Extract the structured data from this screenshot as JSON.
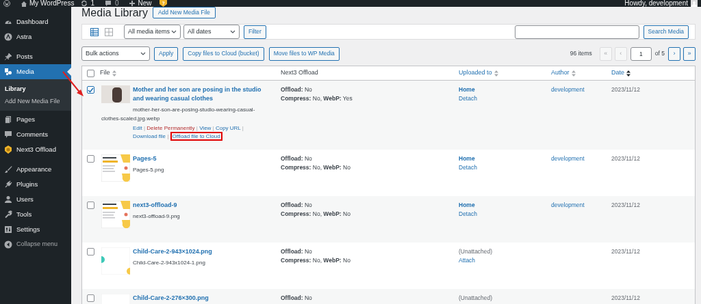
{
  "admin_bar": {
    "items": [
      {
        "kind": "wp-logo"
      },
      {
        "kind": "site",
        "label": "My WordPress"
      },
      {
        "kind": "updates",
        "label": "1"
      },
      {
        "kind": "comments",
        "label": "0"
      },
      {
        "kind": "new",
        "label": "New"
      },
      {
        "kind": "plugin"
      }
    ],
    "greeting": "Howdy, development"
  },
  "sidebar": {
    "items": [
      {
        "label": "Dashboard",
        "kind": "dashboard",
        "selected": false
      },
      {
        "label": "Astra",
        "kind": "astra",
        "selected": false
      },
      {
        "label": "Posts",
        "kind": "pin",
        "selected": false
      },
      {
        "label": "Media",
        "kind": "media",
        "selected": true,
        "children": [
          {
            "label": "Library",
            "selected": true
          },
          {
            "label": "Add New Media File",
            "selected": false
          }
        ]
      },
      {
        "label": "Pages",
        "kind": "pages",
        "selected": false
      },
      {
        "label": "Comments",
        "kind": "comments",
        "selected": false
      },
      {
        "label": "Next3 Offload",
        "kind": "shield",
        "selected": false
      },
      {
        "label": "Appearance",
        "kind": "brush",
        "selected": false
      },
      {
        "label": "Plugins",
        "kind": "plug",
        "selected": false
      },
      {
        "label": "Users",
        "kind": "user",
        "selected": false
      },
      {
        "label": "Tools",
        "kind": "wrench",
        "selected": false
      },
      {
        "label": "Settings",
        "kind": "settings",
        "selected": false
      }
    ],
    "collapse": "Collapse menu"
  },
  "page": {
    "title": "Media Library",
    "add_new_button": "Add New Media File"
  },
  "filters": {
    "view_modes": [
      {
        "kind": "list",
        "selected": true
      },
      {
        "kind": "grid",
        "selected": false
      }
    ],
    "selects": [
      "All media items",
      "All dates"
    ],
    "filter_button": "Filter",
    "search_button": "Search Media"
  },
  "bulk": {
    "select": "Bulk actions",
    "apply": "Apply",
    "buttons": [
      "Copy files to Cloud (bucket)",
      "Move files to WP Media"
    ],
    "items_count": "96 items",
    "pagination": [
      {
        "label": "«",
        "disabled": true
      },
      {
        "label": "‹",
        "disabled": true
      },
      {
        "kind": "page",
        "label": "1"
      },
      {
        "kind": "of",
        "label": "of 5"
      },
      {
        "label": "›",
        "disabled": false
      },
      {
        "label": "»",
        "disabled": false
      }
    ]
  },
  "table": {
    "select_all": {
      "checked": false
    },
    "columns": [
      {
        "label": "File",
        "sortable": true,
        "sorted": false
      },
      {
        "label": "Next3 Offload",
        "sortable": false
      },
      {
        "label": "Uploaded to",
        "sortable": true,
        "sorted": false
      },
      {
        "label": "Author",
        "sortable": true,
        "sorted": false
      },
      {
        "label": "Date",
        "sortable": true,
        "sorted": true
      }
    ],
    "rows": [
      {
        "checked": true,
        "kind": "photo",
        "title": "Mother and her son are posing in the studio and wearing casual clothes",
        "filename": "mother-her-son-are-posing-studio-wearing-casual-clothes-scaled.jpg.webp",
        "actions": [
          {
            "label": "Edit",
            "kind": "link",
            "separator": "|",
            "highlighted": false
          },
          {
            "label": "Delete Permanently",
            "kind": "delete",
            "separator": "|",
            "highlighted": false
          },
          {
            "label": "View",
            "kind": "link",
            "separator": "|",
            "highlighted": false
          },
          {
            "label": "Copy URL",
            "kind": "link",
            "separator": "|",
            "highlighted": false
          },
          {
            "label": "Download file",
            "kind": "link",
            "separator": "|",
            "highlighted": false
          },
          {
            "label": "Offload file to Cloud",
            "kind": "link",
            "highlighted": true
          }
        ],
        "offload_label": "Offload:",
        "offload": "No",
        "compress_label": "Compress:",
        "compress": "No,",
        "webp_label": "WebP:",
        "webp": "Yes",
        "attached": true,
        "uploaded_to": "Home",
        "attach_link": "Detach",
        "author": "development",
        "date": "2023/11/12"
      },
      {
        "checked": false,
        "kind": "screenshot",
        "title": "Pages-5",
        "filename": "Pages-5.png",
        "offload_label": "Offload:",
        "offload": "No",
        "compress_label": "Compress:",
        "compress": "No,",
        "webp_label": "WebP:",
        "webp": "No",
        "attached": true,
        "uploaded_to": "Home",
        "attach_link": "Detach",
        "author": "development",
        "date": "2023/11/12"
      },
      {
        "checked": false,
        "kind": "screenshot",
        "title": "next3-offload-9",
        "filename": "next3-offload-9.png",
        "offload_label": "Offload:",
        "offload": "No",
        "compress_label": "Compress:",
        "compress": "No,",
        "webp_label": "WebP:",
        "webp": "No",
        "attached": true,
        "uploaded_to": "Home",
        "attach_link": "Detach",
        "author": "development",
        "date": "2023/11/12"
      },
      {
        "checked": false,
        "kind": "shapes",
        "title": "Child-Care-2-943×1024.png",
        "filename": "Child-Care-2-943x1024-1.png",
        "offload_label": "Offload:",
        "offload": "No",
        "compress_label": "Compress:",
        "compress": "No,",
        "webp_label": "WebP:",
        "webp": "No",
        "attached": false,
        "uploaded_to": "(Unattached)",
        "attach_link": "Attach",
        "date": "2023/11/12"
      },
      {
        "checked": false,
        "kind": "blank",
        "title": "Child-Care-2-276×300.png",
        "offload_label": "Offload:",
        "offload": "No",
        "attached": false,
        "uploaded_to": "(Unattached)",
        "date": "2023/11/12"
      }
    ]
  }
}
